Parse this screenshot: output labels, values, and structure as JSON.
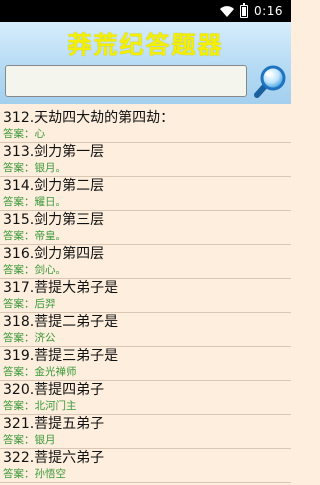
{
  "status_bar": {
    "time": "0:16",
    "icons": [
      "wifi-icon",
      "battery-icon"
    ]
  },
  "header": {
    "title": "莽荒纪答题器"
  },
  "search": {
    "value": "",
    "placeholder": "",
    "icon": "magnifier-icon"
  },
  "answer_label": "答案：",
  "items": [
    {
      "question": "312.天劫四大劫的第四劫：",
      "answer": "心"
    },
    {
      "question": "313.剑力第一层",
      "answer": "银月。"
    },
    {
      "question": "314.剑力第二层",
      "answer": "耀日。"
    },
    {
      "question": "315.剑力第三层",
      "answer": "帝皇。"
    },
    {
      "question": "316.剑力第四层",
      "answer": "剑心。"
    },
    {
      "question": "317.菩提大弟子是",
      "answer": "后羿"
    },
    {
      "question": "318.菩提二弟子是",
      "answer": "济公"
    },
    {
      "question": "319.菩提三弟子是",
      "answer": "金光禅师"
    },
    {
      "question": "320.菩提四弟子",
      "answer": "北河门主"
    },
    {
      "question": "321.菩提五弟子",
      "answer": "银月"
    },
    {
      "question": "322.菩提六弟子",
      "answer": "孙悟空"
    }
  ],
  "colors": {
    "title_text": "#f5f000",
    "header_bg": "#c4e3f8",
    "list_bg": "#fdeedd",
    "answer_text": "#3a9a3a"
  }
}
